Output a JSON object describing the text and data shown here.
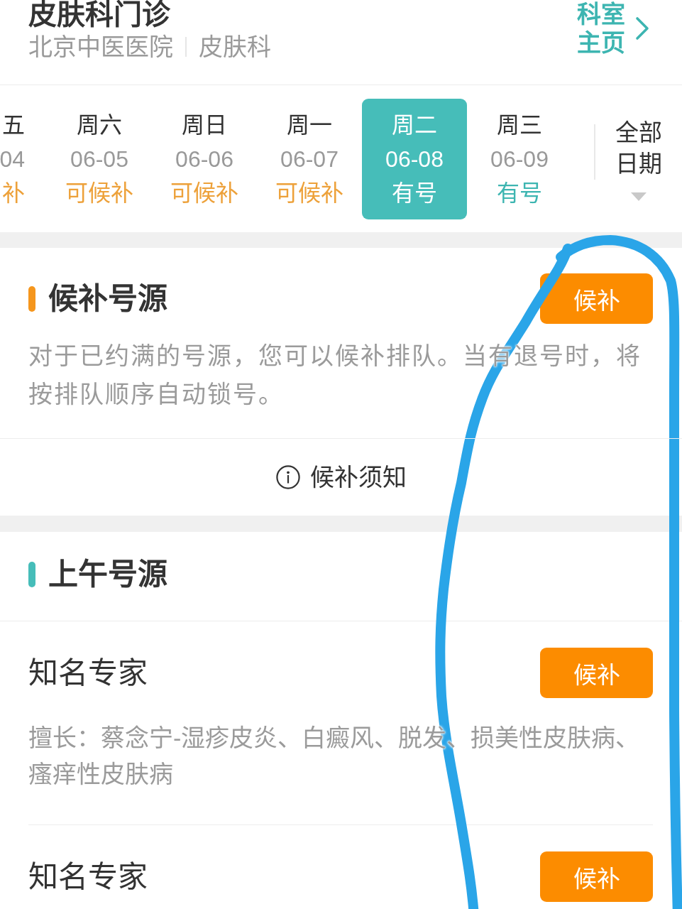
{
  "header": {
    "title": "皮肤科门诊",
    "hospital": "北京中医医院",
    "department": "皮肤科",
    "home_link": "科室主页"
  },
  "date_strip": {
    "days": [
      {
        "weekday": "五",
        "date": "04",
        "status": "补",
        "kind": "waitlist",
        "selected": false
      },
      {
        "weekday": "周六",
        "date": "06-05",
        "status": "可候补",
        "kind": "waitlist",
        "selected": false
      },
      {
        "weekday": "周日",
        "date": "06-06",
        "status": "可候补",
        "kind": "waitlist",
        "selected": false
      },
      {
        "weekday": "周一",
        "date": "06-07",
        "status": "可候补",
        "kind": "waitlist",
        "selected": false
      },
      {
        "weekday": "周二",
        "date": "06-08",
        "status": "有号",
        "kind": "available",
        "selected": true
      },
      {
        "weekday": "周三",
        "date": "06-09",
        "status": "有号",
        "kind": "available",
        "selected": false
      }
    ],
    "all_dates": "全部日期"
  },
  "sections": [
    {
      "kind": "waitlist",
      "title": "候补号源",
      "button": "候补",
      "description": "对于已约满的号源，您可以候补排队。当有退号时，将按排队顺序自动锁号。",
      "notice_link": "候补须知"
    },
    {
      "kind": "session",
      "title": "上午号源",
      "doctors": [
        {
          "title": "知名专家",
          "button": "候补",
          "specialty": "擅长：蔡念宁-湿疹皮炎、白癜风、脱发、损美性皮肤病、瘙痒性皮肤病"
        },
        {
          "title": "知名专家",
          "button": "候补"
        }
      ]
    }
  ]
}
